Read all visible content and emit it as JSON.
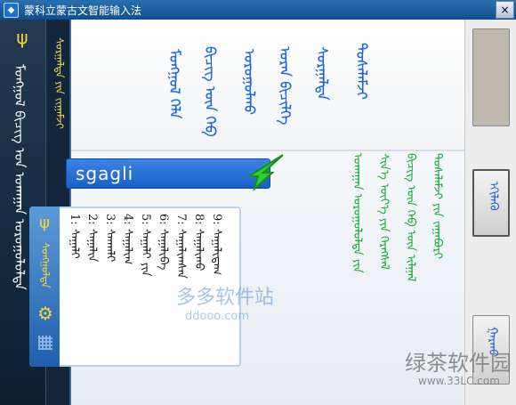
{
  "window": {
    "title": "蒙科立蒙古文智能输入法",
    "close_label": "×"
  },
  "sidebar": {
    "logo_label": "ᠲᠠᠮᠭ᠎ᠠ",
    "vertical_text": "ᠮᠣᠩᠭᠣᠯ ᠪᠢᠴᠢᠭ ᠤᠨ ᠤᠬᠠᠭᠠᠨ ᠣᠷᠤᠭᠤᠯᠤᠯᠲᠠ"
  },
  "strip": {
    "vertical_text": "ᠰᠤᠷᠭᠠᠯᠲᠠ ᠶᠢᠨ ᠵᠢᠭᠠᠮᠵᠢ"
  },
  "main": {
    "top_words": [
      "ᠮᠣᠩᠭᠣᠯ ᠬᠡᠯᠡ",
      "ᠪᠢᠴᠢᠭ ᠦᠨ ᠬᠡᠪ",
      "ᠣᠷᠤᠭᠤᠯᠬᠤ",
      "ᠤᠷᠠᠨ ᠪᠢᠴᠢᠯᠭᠡ",
      "ᠰᠤᠷᠭᠠᠯᠲᠠ",
      "ᠲᠤᠰᠠᠯᠠᠮᠵᠢ"
    ],
    "search_value": "sgagli"
  },
  "candidate_panel": {
    "logo_label": "ᠲᠠᠮᠭ᠎ᠠ",
    "mongol_label": "ᠰᠣᠩᠭᠣᠯᠲᠠ",
    "gear_label": "⚙",
    "candidates": [
      "1: ᠰᠠᠭᠠᠯᠢ",
      "2: ᠰᠠᠭᠠᠯᠢᠨ",
      "3: ᠰᠭᠠᠭᠯᠢ",
      "4: ᠰᠠᠭᠠᠯᠢᠭ",
      "5: ᠰᠠᠭᠠᠯᠢ ᠶᠢᠨ",
      "6: ᠰᠠᠭᠠᠯᠢᠪᠠ",
      "7: ᠰᠠᠭᠠᠯᠢᠭᠰᠠᠨ",
      "8: ᠰᠠᠭᠠᠯᠢᠬᠤ",
      "9: ᠰᠠᠭᠠᠯᠢᠳᠠᠭ"
    ]
  },
  "right_text": [
    "ᠤᠬᠠᠭᠠᠨ ᠣᠷᠤᠭᠤᠯᠤᠯᠲᠠ ᠶᠢᠨ",
    "ᠰᠢᠨ᠎ᠡ ᠦᠶ᠎ᠡ ᠶᠢᠨ ᠬᠡᠷᠡᠭᠰᠡᠯ",
    "ᠪᠢᠴᠢᠭ ᠦᠨ ᠬᠡᠪ ᠦᠨ ᠢᠯᠭᠠᠯ",
    "ᠲᠤᠰᠠᠯᠠᠮᠵᠢ ᠶᠢᠨ ᠵᠠᠭᠠᠪᠤᠷᠢ"
  ],
  "rightbar": {
    "mid_label": "ᠡᠬᠢᠯᠡᠬᠦ",
    "bot_label": "ᠭᠠᠷᠬᠤ"
  },
  "watermarks": {
    "w1": "多多软件站",
    "w2": "ddooo.com",
    "w3": "绿茶软件园",
    "w4": "www.33LC.com"
  },
  "colors": {
    "accent_blue": "#1e64d8",
    "green": "#12a832",
    "gold": "#f7d533"
  }
}
